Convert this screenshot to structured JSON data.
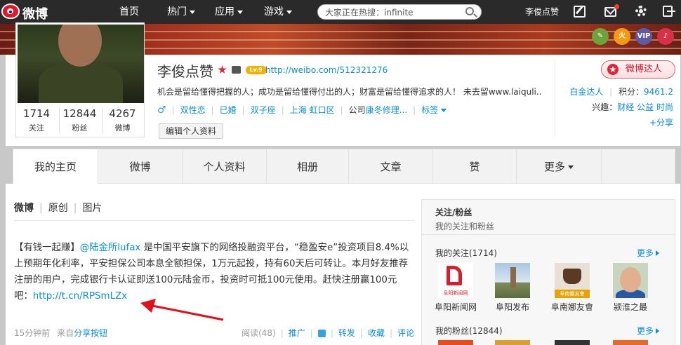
{
  "topnav": {
    "logo_text": "微博",
    "links": [
      "首页",
      "热门",
      "应用",
      "游戏"
    ],
    "search_placeholder": "大家正在热搜：infinite",
    "username": "李俊点赞"
  },
  "cover": {
    "icons": [
      "pen-badge-icon",
      "fire-badge-icon",
      "vip-badge-icon",
      "mic-badge-icon"
    ],
    "vip_text": "VIP",
    "fire_text": "火"
  },
  "profile": {
    "name": "李俊点赞",
    "level": "Lv.9",
    "url": "http://weibo.com/512321276",
    "bio": "机会是留给懂得把握的人；成功是留给懂得付出的人；财富是留给懂得追求的人！ 未去留www.laiquli...",
    "gender_symbol": "♂",
    "tags": [
      "双性恋",
      "已婚",
      "双子座",
      "上海 虹口区"
    ],
    "company_prefix": "公司",
    "company": "康冬修理...",
    "tag_label": "标签",
    "edit_button": "编辑个人资料",
    "stats": [
      {
        "num": "1714",
        "label": "关注"
      },
      {
        "num": "12844",
        "label": "粉丝"
      },
      {
        "num": "4267",
        "label": "微博"
      }
    ],
    "talent_label": "微博达人",
    "rank_link": "白金达人",
    "score_label": "积分：",
    "score_value": "9461.2",
    "interest_label": "兴趣：",
    "interests": [
      "财经",
      "公益",
      "时尚"
    ],
    "share_label": "+分享"
  },
  "tabs": [
    "我的主页",
    "微博",
    "个人资料",
    "相册",
    "文章",
    "赞",
    "更多"
  ],
  "feed": {
    "subtabs": [
      "微博",
      "原创",
      "图片"
    ],
    "post_prefix": "【有钱一起赚】",
    "post_mention": "@陆金所lufax",
    "post_body": " 是中国平安旗下的网络投融资平台，“稳盈安e”投资项目8.4%以上预期年化利率，平安担保公司本息全额担保，1万元起投，持有60天后可转让。本月好友推荐注册的用户，完成银行卡认证即送100元陆金币，投资时可抵100元使用。赶快注册赢100元吧：",
    "post_link": "http://t.cn/RPSmLZx",
    "time": "15分钟前",
    "source_prefix": "来自",
    "source": "分享按钮",
    "read_label": "阅读(48)",
    "actions": [
      "推广",
      "",
      "转发",
      "收藏",
      "评论"
    ]
  },
  "side": {
    "title": "关注/粉丝",
    "subtitle": "我的关注和粉丝",
    "following_label": "我的关注(1714)",
    "fans_label": "我的粉丝(12844)",
    "more_label": "更多",
    "following": [
      {
        "name": "阜阳新闻网",
        "pic_caption": "阜阳新闻网"
      },
      {
        "name": "阜阳发布"
      },
      {
        "name": "阜南娜友會",
        "pic_caption": "阜南娜友會"
      },
      {
        "name": "颍淮之最"
      }
    ]
  },
  "colors": {
    "link": "#0a8cd2",
    "brand_red": "#e6162d",
    "nav_bg": "#2a2a2a"
  }
}
